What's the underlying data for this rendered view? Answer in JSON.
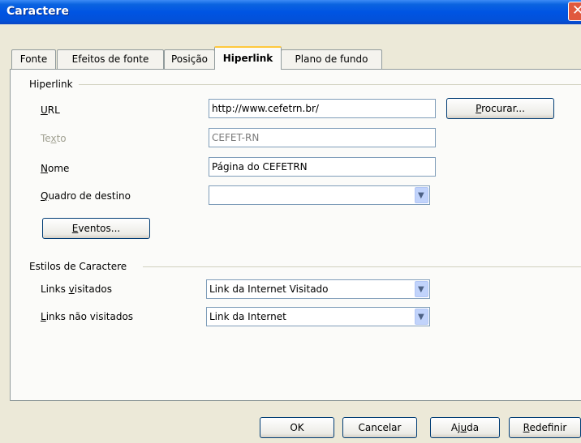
{
  "window": {
    "title": "Caractere",
    "close_symbol": "✕"
  },
  "tabs": [
    {
      "label": "Fonte",
      "active": false
    },
    {
      "label": "Efeitos de fonte",
      "active": false
    },
    {
      "label": "Posição",
      "active": false
    },
    {
      "label": "Hiperlink",
      "active": true
    },
    {
      "label": "Plano de fundo",
      "active": false
    }
  ],
  "hyperlink": {
    "group_label": "Hiperlink",
    "url": {
      "label_pre": "",
      "label_key": "U",
      "label_post": "RL",
      "value": "http://www.cefetrn.br/"
    },
    "browse_button": {
      "label_key": "P",
      "label_rest": "rocurar..."
    },
    "text": {
      "label_pre": "Te",
      "label_key": "x",
      "label_post": "to",
      "value": "CEFET-RN"
    },
    "name": {
      "label_pre": "",
      "label_key": "N",
      "label_post": "ome",
      "value": "Página do CEFETRN"
    },
    "target_frame": {
      "label_pre": "",
      "label_key": "Q",
      "label_post": "uadro de destino",
      "value": ""
    },
    "events_button": {
      "label_key": "E",
      "label_rest": "ventos..."
    }
  },
  "character_styles": {
    "group_label": "Estilos de Caractere",
    "visited": {
      "label_pre": "Links ",
      "label_key": "v",
      "label_post": "isitados",
      "value": "Link da Internet Visitado"
    },
    "unvisited": {
      "label_pre": "",
      "label_key": "L",
      "label_post": "inks não visitados",
      "value": "Link da Internet"
    }
  },
  "buttons": {
    "ok": "OK",
    "cancel": "Cancelar",
    "help_pre": "Aj",
    "help_key": "u",
    "help_post": "da",
    "reset_key": "R",
    "reset_rest": "edefinir"
  },
  "dropdown_symbol": "▼"
}
